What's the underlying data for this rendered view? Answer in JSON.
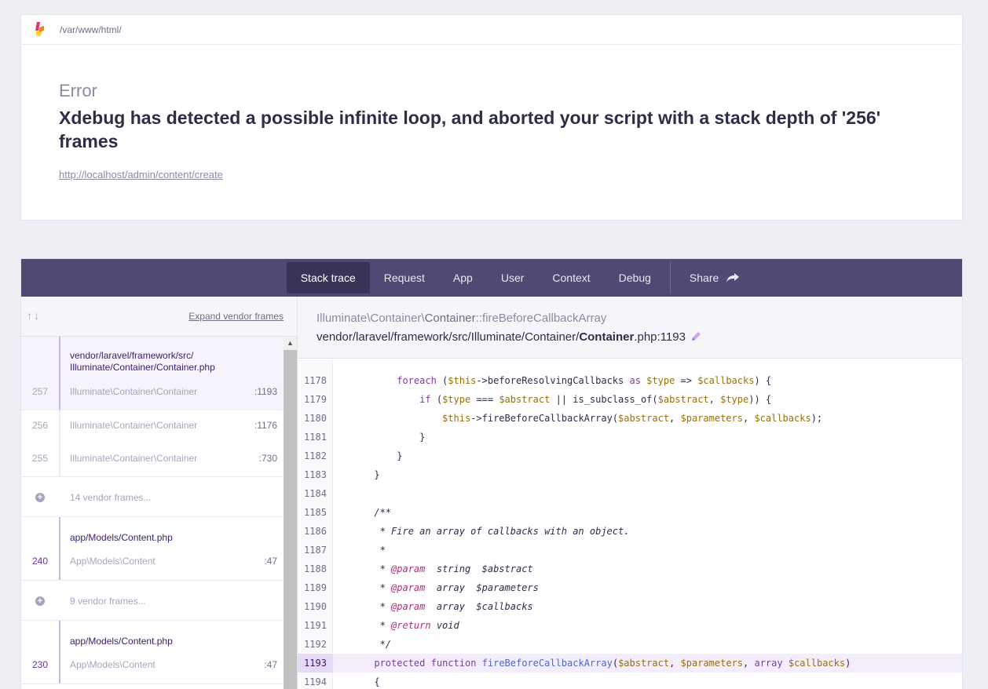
{
  "header": {
    "path": "/var/www/html/",
    "error_type": "Error",
    "message": "Xdebug has detected a possible infinite loop, and aborted your script with a stack depth of '256' frames",
    "url": "http://localhost/admin/content/create"
  },
  "nav": {
    "tabs": [
      "Stack trace",
      "Request",
      "App",
      "User",
      "Context",
      "Debug"
    ],
    "active": "Stack trace",
    "share_label": "Share"
  },
  "stack": {
    "expand_label": "Expand vendor frames",
    "frames": [
      {
        "num": "257",
        "file": "vendor/laravel/framework/src/\nIlluminate/Container/Container.php",
        "cls": "Illuminate\\Container\\Container",
        "line": ":1193"
      },
      {
        "num": "256",
        "cls": "Illuminate\\Container\\Container",
        "line": ":1176"
      },
      {
        "num": "255",
        "cls": "Illuminate\\Container\\Container",
        "line": ":730"
      },
      {
        "vendor": "14 vendor frames..."
      },
      {
        "num": "240",
        "file": "app/Models/Content.php",
        "cls": "App\\Models\\Content",
        "line": ":47"
      },
      {
        "vendor": "9 vendor frames..."
      },
      {
        "num": "230",
        "file": "app/Models/Content.php",
        "cls": "App\\Models\\Content",
        "line": ":47"
      }
    ]
  },
  "detail": {
    "class_ns": "Illuminate\\Container\\",
    "class_name": "Container",
    "method": "::fireBeforeCallbackArray",
    "file_prefix": "vendor/laravel/framework/src/Illuminate/Container/",
    "file_name": "Container",
    "file_suffix": ".php:1193"
  },
  "code": {
    "highlight": "1193",
    "lines": [
      {
        "n": "1178"
      },
      {
        "n": "1179"
      },
      {
        "n": "1180"
      },
      {
        "n": "1181"
      },
      {
        "n": "1182"
      },
      {
        "n": "1183"
      },
      {
        "n": "1184"
      },
      {
        "n": "1185"
      },
      {
        "n": "1186"
      },
      {
        "n": "1187"
      },
      {
        "n": "1188"
      },
      {
        "n": "1189"
      },
      {
        "n": "1190"
      },
      {
        "n": "1191"
      },
      {
        "n": "1192"
      },
      {
        "n": "1193"
      },
      {
        "n": "1194"
      }
    ]
  },
  "colors": {
    "nav_bg": "#4e4a74",
    "accent": "#6b2fb8",
    "highlight": "#f4eefc"
  }
}
